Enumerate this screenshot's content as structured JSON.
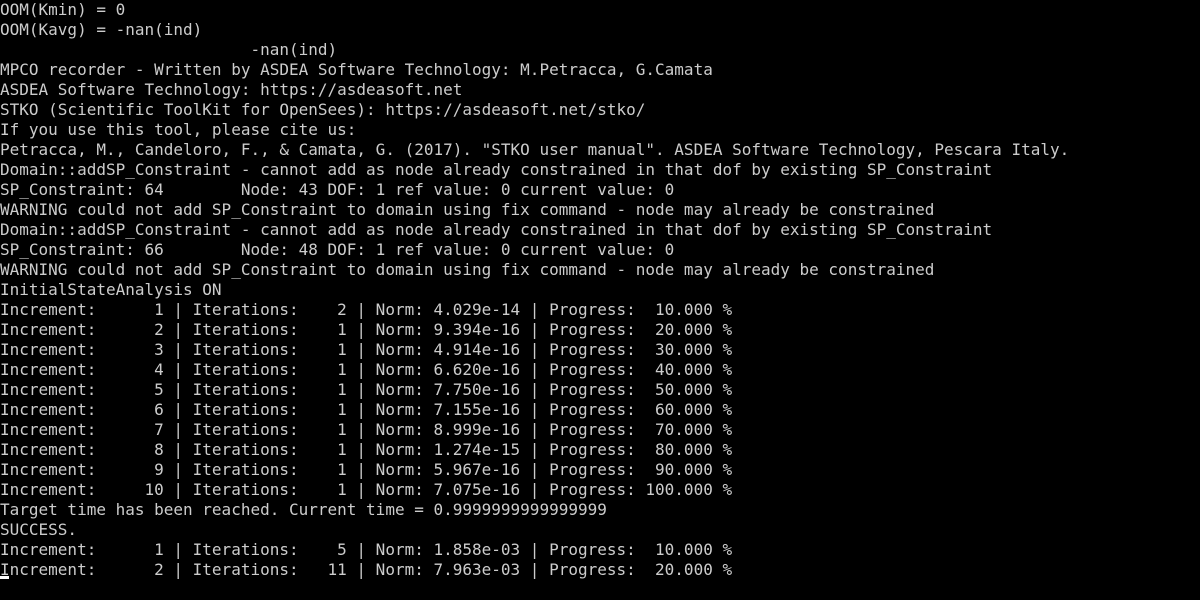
{
  "console": {
    "lines": [
      "OOM(Kmin) = 0",
      "OOM(Kavg) = -nan(ind)",
      "                          -nan(ind)",
      "MPCO recorder - Written by ASDEA Software Technology: M.Petracca, G.Camata",
      "ASDEA Software Technology: https://asdeasoft.net",
      "STKO (Scientific ToolKit for OpenSees): https://asdeasoft.net/stko/",
      "If you use this tool, please cite us:",
      "Petracca, M., Candeloro, F., & Camata, G. (2017). \"STKO user manual\". ASDEA Software Technology, Pescara Italy.",
      "Domain::addSP_Constraint - cannot add as node already constrained in that dof by existing SP_Constraint",
      "SP_Constraint: 64        Node: 43 DOF: 1 ref value: 0 current value: 0",
      "WARNING could not add SP_Constraint to domain using fix command - node may already be constrained",
      "Domain::addSP_Constraint - cannot add as node already constrained in that dof by existing SP_Constraint",
      "SP_Constraint: 66        Node: 48 DOF: 1 ref value: 0 current value: 0",
      "WARNING could not add SP_Constraint to domain using fix command - node may already be constrained",
      "InitialStateAnalysis ON",
      "Increment:      1 | Iterations:    2 | Norm: 4.029e-14 | Progress:  10.000 %",
      "Increment:      2 | Iterations:    1 | Norm: 9.394e-16 | Progress:  20.000 %",
      "Increment:      3 | Iterations:    1 | Norm: 4.914e-16 | Progress:  30.000 %",
      "Increment:      4 | Iterations:    1 | Norm: 6.620e-16 | Progress:  40.000 %",
      "Increment:      5 | Iterations:    1 | Norm: 7.750e-16 | Progress:  50.000 %",
      "Increment:      6 | Iterations:    1 | Norm: 7.155e-16 | Progress:  60.000 %",
      "Increment:      7 | Iterations:    1 | Norm: 8.999e-16 | Progress:  70.000 %",
      "Increment:      8 | Iterations:    1 | Norm: 1.274e-15 | Progress:  80.000 %",
      "Increment:      9 | Iterations:    1 | Norm: 5.967e-16 | Progress:  90.000 %",
      "Increment:     10 | Iterations:    1 | Norm: 7.075e-16 | Progress: 100.000 %",
      "Target time has been reached. Current time = 0.9999999999999999",
      "SUCCESS.",
      "Increment:      1 | Iterations:    5 | Norm: 1.858e-03 | Progress:  10.000 %",
      "Increment:      2 | Iterations:   11 | Norm: 7.963e-03 | Progress:  20.000 %"
    ]
  },
  "colors": {
    "background": "#000000",
    "text": "#cccccc",
    "cursor": "#ffffff"
  }
}
